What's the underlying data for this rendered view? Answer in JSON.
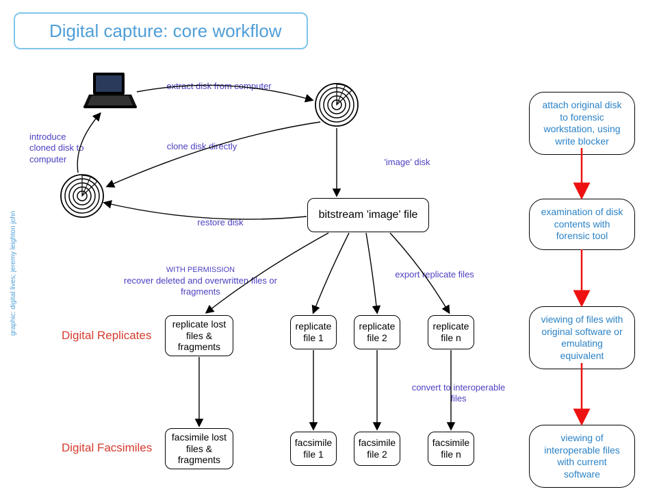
{
  "title": "Digital capture: core workflow",
  "credit": "graphic: digital lives; jeremy leighton john",
  "labels": {
    "extract": "extract disk from computer",
    "introduce": "introduce cloned disk to computer",
    "clone": "clone disk directly",
    "image": "'image' disk",
    "restore": "restore disk",
    "permission_header": "WITH PERMISSION",
    "permission_body": "recover deleted and overwritten files or fragments",
    "export": "export replicate files",
    "convert": "convert to interoperable files"
  },
  "sections": {
    "replicates": "Digital Replicates",
    "facsimiles": "Digital Facsimiles"
  },
  "nodes": {
    "bitstream": "bitstream 'image' file",
    "replicate_lost": "replicate lost files & fragments",
    "replicate1": "replicate file 1",
    "replicate2": "replicate file 2",
    "replicaten": "replicate file n",
    "facsimile_lost": "facsimile lost files & fragments",
    "facsimile1": "facsimile file 1",
    "facsimile2": "facsimile file 2",
    "facsimilen": "facsimile file n"
  },
  "pills": {
    "attach": "attach original disk to forensic workstation, using write blocker",
    "examine": "examination of disk contents with forensic tool",
    "viewing_original": "viewing of files with original software or emulating equivalent",
    "viewing_interop": "viewing of interoperable files with current software"
  }
}
